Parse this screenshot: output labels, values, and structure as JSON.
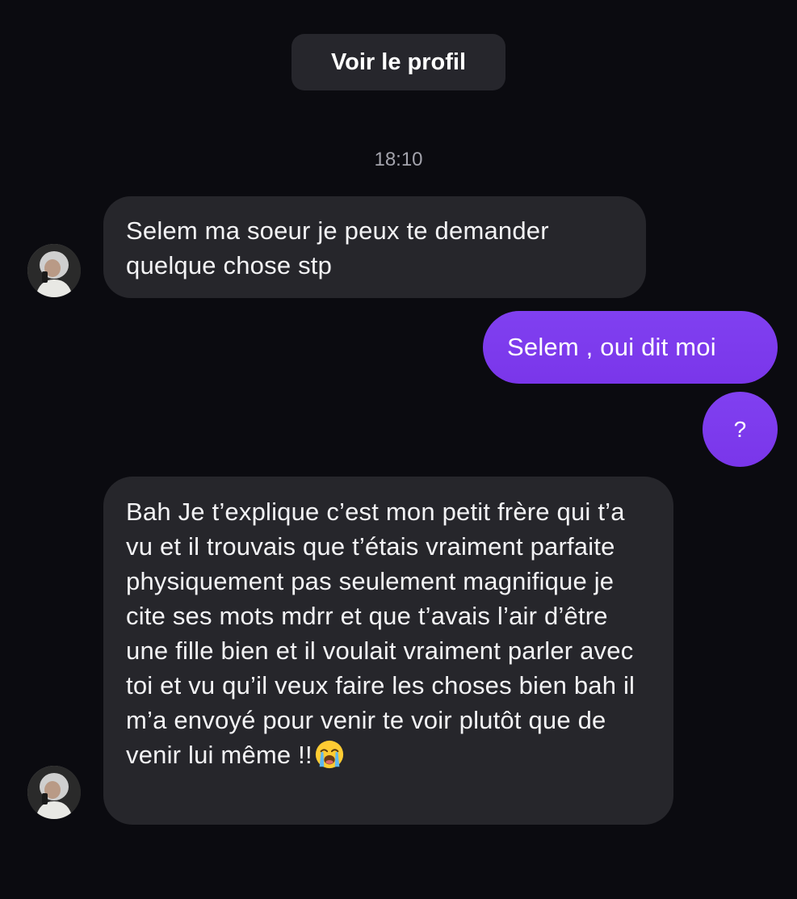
{
  "header": {
    "profile_button_label": "Voir le profil"
  },
  "conversation": {
    "timestamp": "18:10",
    "messages": [
      {
        "sender": "them",
        "text": "Selem ma soeur je peux te demander quelque chose stp"
      },
      {
        "sender": "me",
        "text": "Selem , oui dit moi"
      },
      {
        "sender": "me",
        "text": "?"
      },
      {
        "sender": "them",
        "text": "Bah Je t’explique c’est mon petit frère qui t’a vu et il trouvais que t’étais vraiment parfaite physiquement pas seulement magnifique je cite ses mots mdrr et que t’avais l’air d’être une fille bien et il voulait vraiment parler avec toi et vu qu’il veux faire les choses bien bah il m’a envoyé pour venir te voir plutôt que de venir lui même !!",
        "emoji": "loudly-crying-face-icon"
      }
    ]
  },
  "colors": {
    "background": "#0b0b10",
    "incoming_bubble": "#26262b",
    "outgoing_bubble": "#7c3aed",
    "timestamp_text": "#a3a3ac"
  }
}
